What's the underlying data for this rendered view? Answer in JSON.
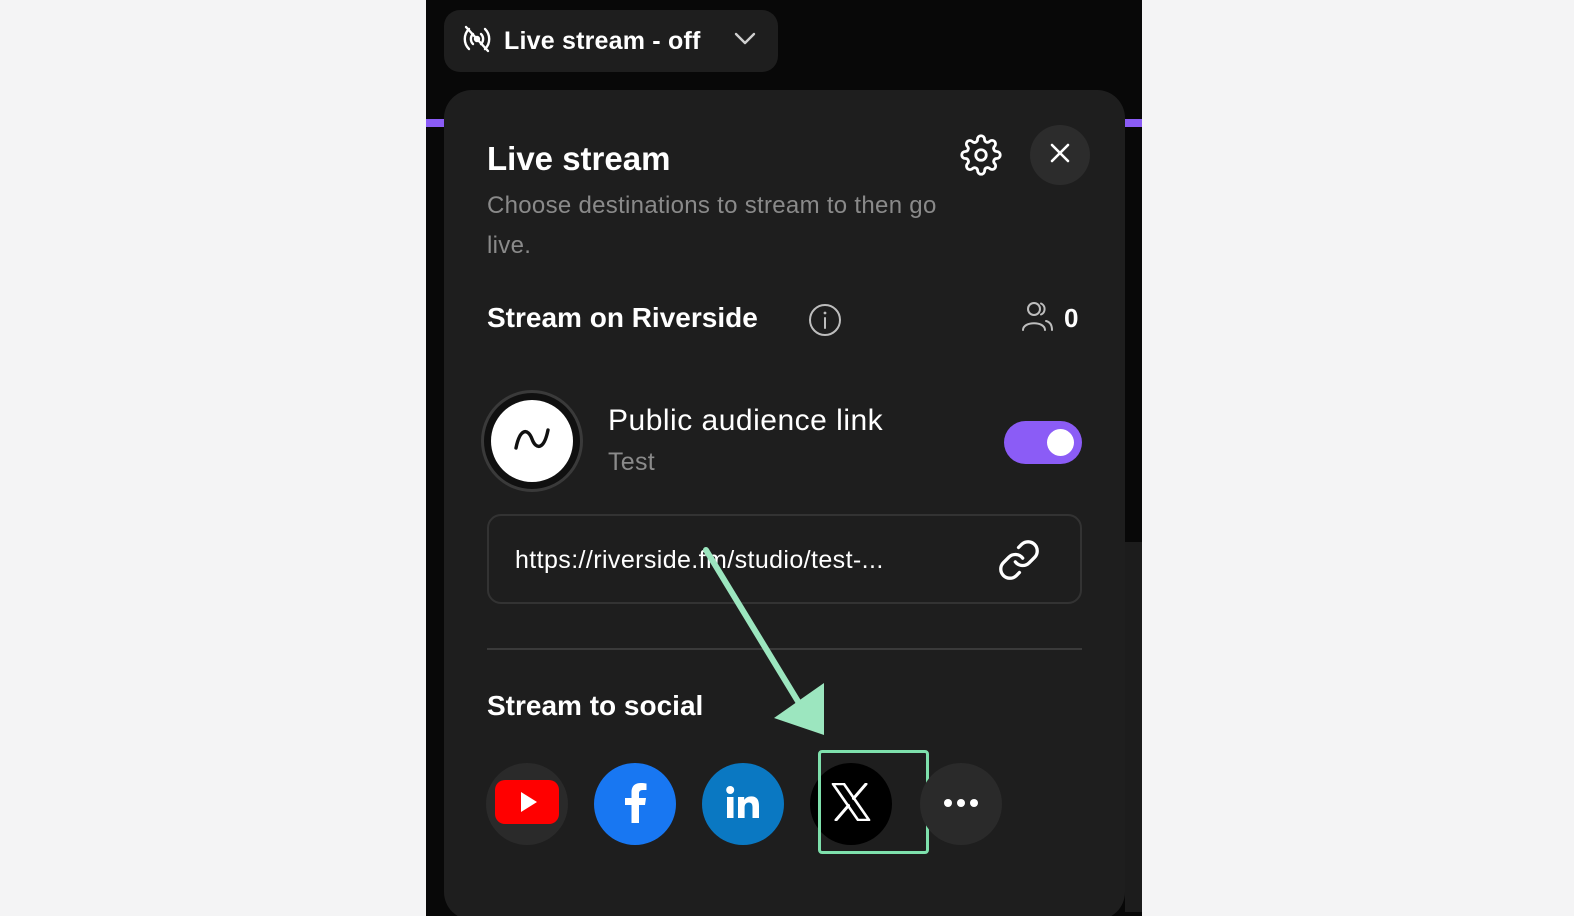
{
  "header": {
    "dropdown_label": "Live stream - off",
    "broadcast_icon": "broadcast-off-icon",
    "chevron_icon": "chevron-down-icon"
  },
  "panel": {
    "title": "Live stream",
    "subtitle": "Choose destinations to stream to then go live.",
    "settings_icon": "gear-icon",
    "close_icon": "close-icon",
    "riverside": {
      "section_title": "Stream on Riverside",
      "viewer_count": "0",
      "link_name": "Public audience link",
      "link_subtitle": "Test",
      "toggle_on": true,
      "url": "https://riverside.fm/studio/test-..."
    },
    "social": {
      "section_title": "Stream to social",
      "platforms": [
        "youtube-icon",
        "facebook-icon",
        "linkedin-icon",
        "x-icon",
        "more-icon"
      ]
    }
  },
  "colors": {
    "accent": "#8b5cf6",
    "highlight": "#7ee0ac",
    "youtube": "#ff0000",
    "facebook": "#1877f2",
    "linkedin": "#0a78c2"
  }
}
